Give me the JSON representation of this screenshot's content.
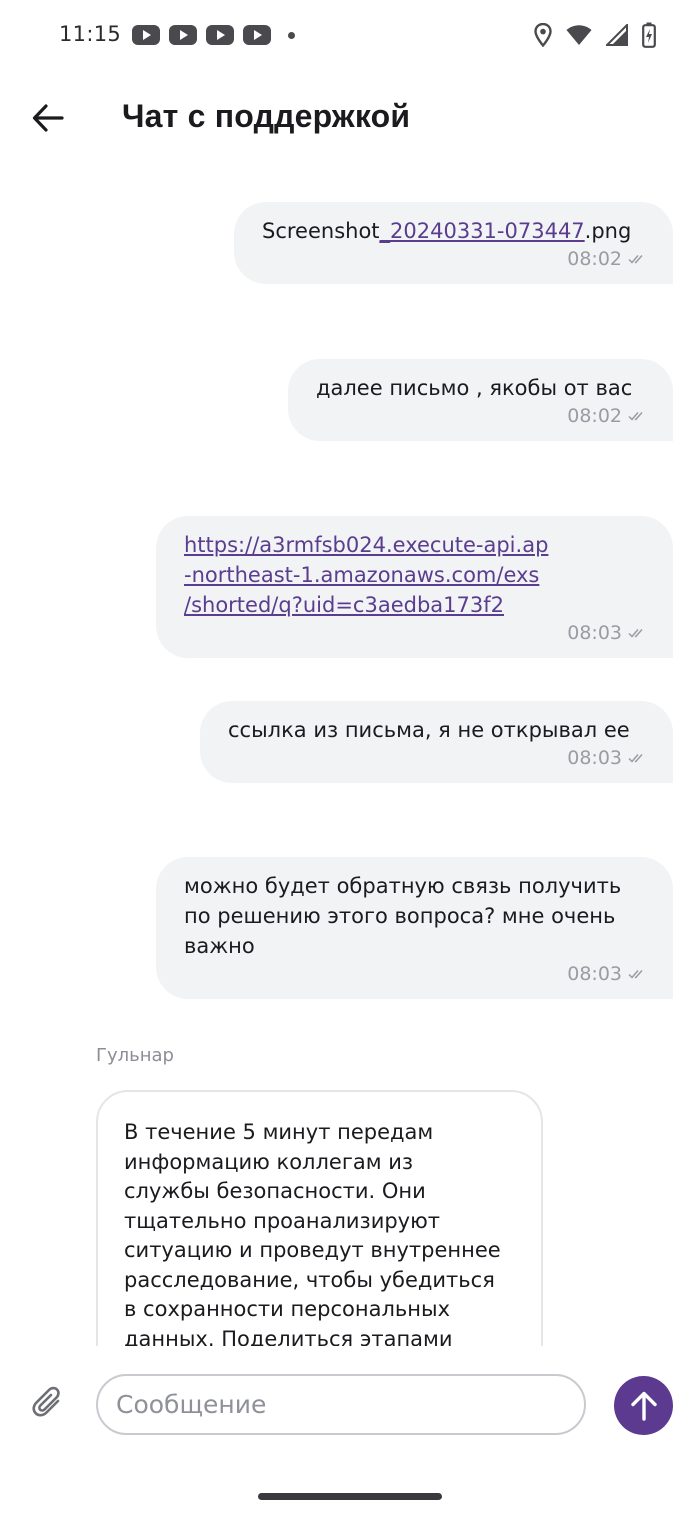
{
  "status_bar": {
    "time": "11:15",
    "notification_icons": [
      "youtube-icon",
      "youtube-icon",
      "youtube-icon",
      "youtube-icon",
      "dot-icon"
    ],
    "system_icons": [
      "location-icon",
      "wifi-icon",
      "signal-icon",
      "battery-charging-icon"
    ]
  },
  "header": {
    "title": "Чат с поддержкой",
    "back_icon": "arrow-left-icon"
  },
  "messages": [
    {
      "direction": "outgoing",
      "text_prefix": "Screenshot",
      "text_link": "_20240331-073447",
      "text_suffix": ".png",
      "time": "08:02",
      "status_icon": "double-check-icon"
    },
    {
      "direction": "outgoing",
      "text": "далее письмо , якобы от вас",
      "time": "08:02",
      "status_icon": "double-check-icon"
    },
    {
      "direction": "outgoing",
      "link_lines": [
        "https://a3rmfsb024.execute-api.ap",
        "-northeast-1.amazonaws.com/exs",
        "/shorted/q?uid=c3aedba173f2"
      ],
      "time": "08:03",
      "status_icon": "double-check-icon"
    },
    {
      "direction": "outgoing",
      "text": "ссылка из письма, я не открывал ее",
      "time": "08:03",
      "status_icon": "double-check-icon"
    },
    {
      "direction": "outgoing",
      "lines": [
        "можно будет обратную связь получить",
        "по решению этого вопроса? мне очень",
        "важно"
      ],
      "time": "08:03",
      "status_icon": "double-check-icon"
    },
    {
      "direction": "incoming",
      "sender": "Гульнар",
      "lines": [
        "В течение 5 минут передам",
        "информацию коллегам из",
        "службы безопасности. Они",
        "тщательно проанализируют",
        "ситуацию и проведут внутреннее",
        "расследование, чтобы убедиться",
        "в сохранности персональных",
        "данных. Поделиться этапами"
      ]
    }
  ],
  "composer": {
    "placeholder": "Сообщение",
    "value": "",
    "attach_icon": "paperclip-icon",
    "send_icon": "arrow-up-icon"
  },
  "colors": {
    "accent": "#5b3a8f",
    "link": "#5a3d8e",
    "bubble_out_bg": "#f2f3f5",
    "meta_text": "#9a9ca3"
  }
}
